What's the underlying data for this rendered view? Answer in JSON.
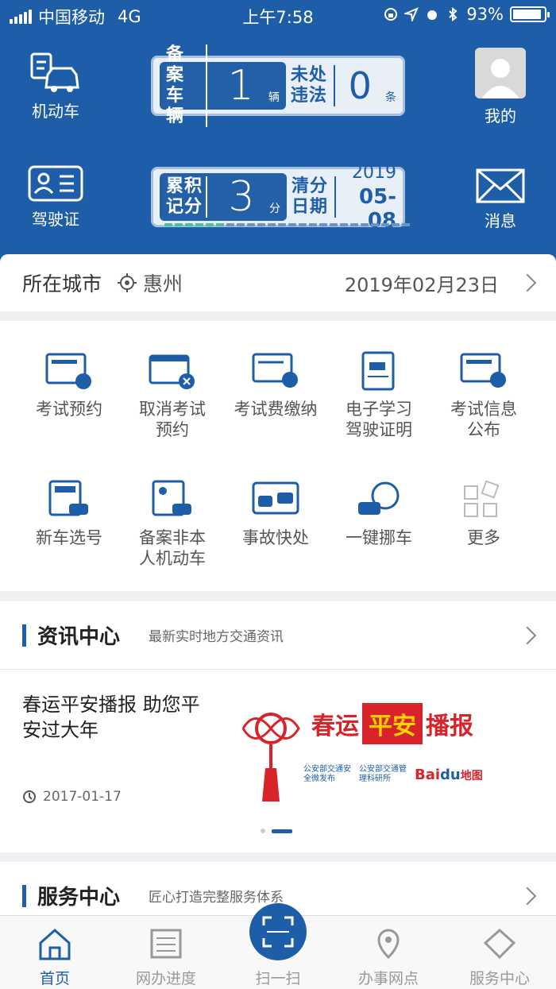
{
  "status": {
    "carrier": "中国移动",
    "network": "4G",
    "time": "上午7:58",
    "battery": "93%",
    "battery_level": 0.93
  },
  "header": {
    "vehicle_label": "机动车",
    "license_label": "驾驶证",
    "mine_label": "我的",
    "message_label": "消息",
    "registered": {
      "label_1": "备案",
      "label_2": "车辆",
      "value": "1",
      "unit": "辆"
    },
    "violation": {
      "label_1": "未处",
      "label_2": "违法",
      "value": "0",
      "unit": "条"
    },
    "points": {
      "label_1": "累积",
      "label_2": "记分",
      "value": "3",
      "unit": "分",
      "progress": 0.25
    },
    "clear": {
      "label_1": "清分",
      "label_2": "日期",
      "year": "2019",
      "date": "05-08"
    }
  },
  "city": {
    "label": "所在城市",
    "name": "惠州",
    "date": "2019年02月23日"
  },
  "services": [
    {
      "line1": "考试预约",
      "line2": "",
      "icon": "exam-reserve-icon"
    },
    {
      "line1": "取消考试",
      "line2": "预约",
      "icon": "cancel-exam-icon"
    },
    {
      "line1": "考试费缴纳",
      "line2": "",
      "icon": "exam-fee-icon"
    },
    {
      "line1": "电子学习",
      "line2": "驾驶证明",
      "icon": "e-learning-icon"
    },
    {
      "line1": "考试信息",
      "line2": "公布",
      "icon": "exam-info-icon"
    },
    {
      "line1": "新车选号",
      "line2": "",
      "icon": "plate-select-icon"
    },
    {
      "line1": "备案非本",
      "line2": "人机动车",
      "icon": "register-vehicle-icon"
    },
    {
      "line1": "事故快处",
      "line2": "",
      "icon": "accident-icon"
    },
    {
      "line1": "一键挪车",
      "line2": "",
      "icon": "move-car-icon"
    },
    {
      "line1": "更多",
      "line2": "",
      "icon": "more-icon"
    }
  ],
  "news": {
    "title": "资讯中心",
    "subtitle": "最新实时地方交通资讯",
    "item_title": "春运平安播报 助您平安过大年",
    "item_date": "2017-01-17",
    "banner": {
      "text1": "春运",
      "text2": "平安",
      "text3": "播报",
      "logo1": "公安部交通安全微发布",
      "logo2": "公安部交通管理科研所",
      "logo3": "Bai",
      "logo3b": "du",
      "logo3c": "地图"
    }
  },
  "service_center": {
    "title": "服务中心",
    "subtitle": "匠心打造完整服务体系"
  },
  "tabs": [
    {
      "label": "首页"
    },
    {
      "label": "网办进度"
    },
    {
      "label": "扫一扫"
    },
    {
      "label": "办事网点"
    },
    {
      "label": "服务中心"
    }
  ],
  "colors": {
    "primary": "#1e5da8",
    "accent_green": "#47c29e"
  }
}
